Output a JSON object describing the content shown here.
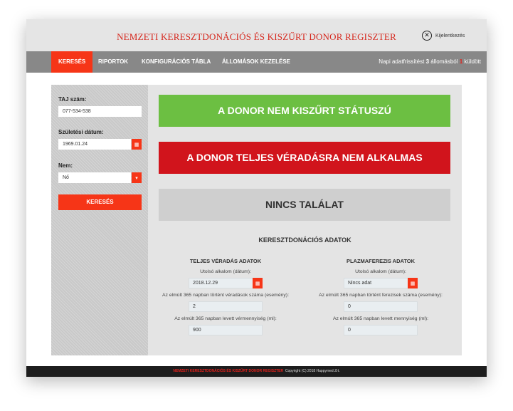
{
  "app": {
    "title": "NEMZETI KERESZTDONÁCIÓS ÉS KISZŰRT DONOR REGISZTER",
    "logout_label": "Kijelentkezés",
    "logout_icon": "close-circle-icon"
  },
  "nav": {
    "items": [
      {
        "label": "KERESÉS",
        "active": true
      },
      {
        "label": "RIPORTOK"
      },
      {
        "label": "KONFIGURÁCIÓS TÁBLA"
      },
      {
        "label": "ÁLLOMÁSOK KEZELÉSE"
      }
    ],
    "status": {
      "prefix": "Napi adatfrissítést",
      "count": "3",
      "middle": "állomásból",
      "failed": "1",
      "suffix": "küldött"
    }
  },
  "sidebar": {
    "taj_label": "TAJ szám:",
    "taj_value": "077-534-538",
    "dob_label": "Születési dátum:",
    "dob_value": "1969.01.24",
    "sex_label": "Nem:",
    "sex_value": "Nő",
    "search_label": "KERESÉS"
  },
  "results": {
    "banner_status": "A DONOR NEM KISZŰRT STÁTUSZÚ",
    "banner_suitability": "A DONOR TELJES VÉRADÁSRA NEM ALKALMAS",
    "banner_match": "NINCS TALÁLAT"
  },
  "cross_donation": {
    "title": "KERESZTDONÁCIÓS ADATOK",
    "whole_blood": {
      "title": "TELJES VÉRADÁS ADATOK",
      "last_label": "Utolsó alkalom (dátum):",
      "last_value": "2018.12.29",
      "count_label": "Az elmúlt 365 napban történt véradások száma (esemény):",
      "count_value": "2",
      "volume_label": "Az elmúlt 365 napban levett vérmennyiség (ml):",
      "volume_value": "900"
    },
    "plasma": {
      "title": "PLAZMAFEREZIS ADATOK",
      "last_label": "Utolsó alkalom (dátum):",
      "last_value": "Nincs adat",
      "count_label": "Az elmúlt 365 napban történt ferezisek száma (esemény):",
      "count_value": "0",
      "volume_label": "Az elmúlt 365 napban levett mennyiség (ml):",
      "volume_value": "0"
    }
  },
  "footer": {
    "brand": "NEMZETI KERESZTDONÁCIÓS ÉS KISZŰRT DONOR REGISZTER",
    "copyright": "Copyright (C) 2018 Happymed Zrt."
  },
  "colors": {
    "accent": "#f63517",
    "success": "#6cbf42",
    "danger": "#d1141c",
    "neutral": "#cfcfcf",
    "title_red": "#d6281e"
  }
}
